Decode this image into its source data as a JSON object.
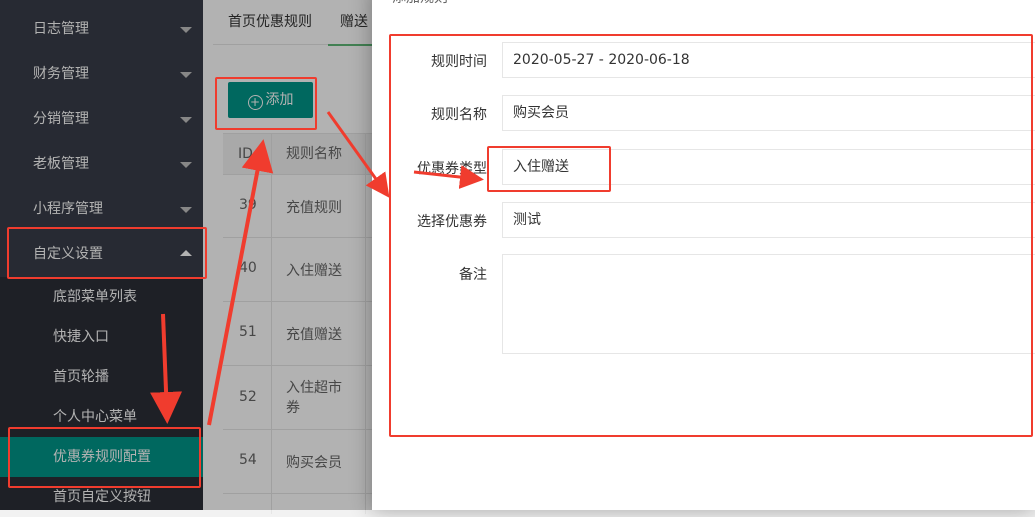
{
  "sidebar": {
    "menu": [
      {
        "label": "日志管理"
      },
      {
        "label": "财务管理"
      },
      {
        "label": "分销管理"
      },
      {
        "label": "老板管理"
      },
      {
        "label": "小程序管理"
      },
      {
        "label": "自定义设置"
      }
    ],
    "submenu": [
      {
        "label": "底部菜单列表"
      },
      {
        "label": "快捷入口"
      },
      {
        "label": "首页轮播"
      },
      {
        "label": "个人中心菜单"
      },
      {
        "label": "优惠券规则配置"
      },
      {
        "label": "首页自定义按钮"
      }
    ]
  },
  "main": {
    "tabs": [
      {
        "label": "首页优惠规则"
      },
      {
        "label": "赠送"
      }
    ],
    "add_button": "添加",
    "table": {
      "headers": [
        "ID",
        "规则名称"
      ],
      "rows": [
        {
          "id": "39",
          "name": "充值规则"
        },
        {
          "id": "40",
          "name": "入住赠送"
        },
        {
          "id": "51",
          "name": "充值赠送"
        },
        {
          "id": "52",
          "name": "入住超市券"
        },
        {
          "id": "54",
          "name": "购买会员"
        }
      ]
    }
  },
  "dialog": {
    "title": "添加规则",
    "fields": {
      "time": {
        "label": "规则时间",
        "value": "2020-05-27 - 2020-06-18"
      },
      "name": {
        "label": "规则名称",
        "value": "购买会员"
      },
      "type": {
        "label": "优惠券类型",
        "value": "入住赠送"
      },
      "coupon": {
        "label": "选择优惠券",
        "value": "测试"
      },
      "remark": {
        "label": "备注",
        "value": ""
      }
    }
  },
  "colors": {
    "sidebar_bg": "#393d49",
    "submenu_bg": "#2b2e37",
    "accent": "#009688",
    "annotation_red": "#f03c2e"
  }
}
